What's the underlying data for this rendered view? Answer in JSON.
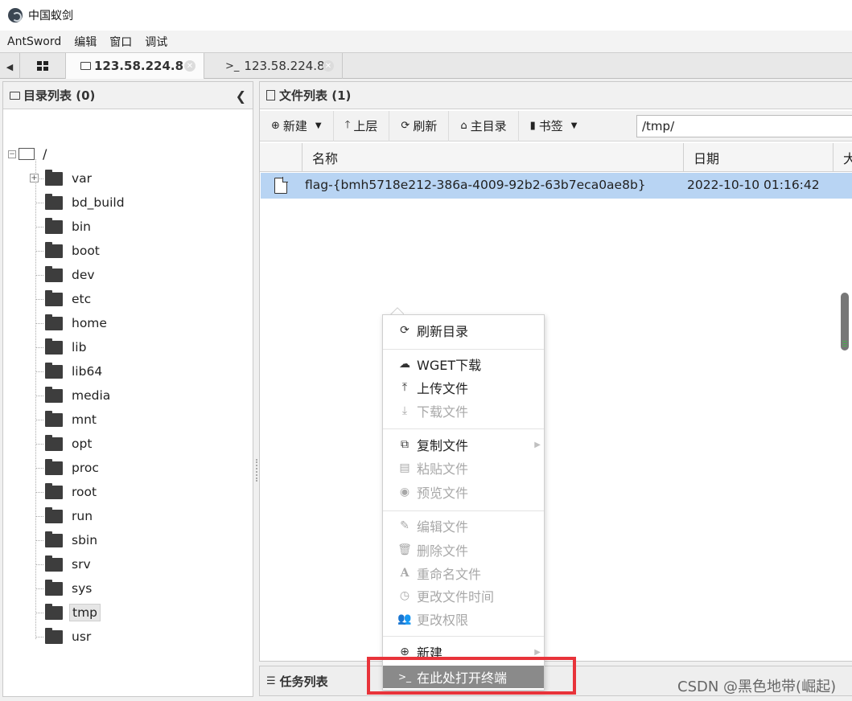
{
  "window": {
    "title": "中国蚁剑",
    "icon": "antsword-logo-icon"
  },
  "menubar": {
    "items": [
      "AntSword",
      "编辑",
      "窗口",
      "调试"
    ]
  },
  "tabs": {
    "left_arrow": "◀",
    "items": [
      {
        "label": "123.58.224.8",
        "icon": "folder-icon",
        "active": true
      },
      {
        "label": "123.58.224.8",
        "icon": "terminal-icon",
        "active": false
      }
    ],
    "close_symbol": "✕"
  },
  "dir_panel": {
    "title": "目录列表 (0)",
    "root_label": "/",
    "nodes": [
      "var",
      "bd_build",
      "bin",
      "boot",
      "dev",
      "etc",
      "home",
      "lib",
      "lib64",
      "media",
      "mnt",
      "opt",
      "proc",
      "root",
      "run",
      "sbin",
      "srv",
      "sys",
      "tmp",
      "usr"
    ],
    "selected": "tmp"
  },
  "file_panel": {
    "title": "文件列表 (1)",
    "toolbar": {
      "new": "新建",
      "up": "上层",
      "refresh": "刷新",
      "home": "主目录",
      "bookmark": "书签"
    },
    "path": "/tmp/",
    "columns": [
      "名称",
      "日期",
      "大"
    ],
    "rows": [
      {
        "name": "flag-{bmh5718e212-386a-4009-92b2-63b7eca0ae8b}",
        "date": "2022-10-10 01:16:42"
      }
    ]
  },
  "task_panel": {
    "title": "任务列表"
  },
  "context_menu": {
    "items": [
      {
        "label": "刷新目录",
        "icon": "refresh-icon",
        "enabled": true
      },
      {
        "label": "WGET下载",
        "icon": "cloud-download-icon",
        "enabled": true
      },
      {
        "label": "上传文件",
        "icon": "upload-icon",
        "enabled": true
      },
      {
        "label": "下载文件",
        "icon": "download-icon",
        "enabled": false
      },
      {
        "label": "复制文件",
        "icon": "copy-icon",
        "enabled": true,
        "submenu": true
      },
      {
        "label": "粘贴文件",
        "icon": "paste-icon",
        "enabled": false
      },
      {
        "label": "预览文件",
        "icon": "eye-icon",
        "enabled": false
      },
      {
        "label": "编辑文件",
        "icon": "edit-icon",
        "enabled": false
      },
      {
        "label": "删除文件",
        "icon": "trash-icon",
        "enabled": false
      },
      {
        "label": "重命名文件",
        "icon": "font-icon",
        "enabled": false
      },
      {
        "label": "更改文件时间",
        "icon": "clock-icon",
        "enabled": false
      },
      {
        "label": "更改权限",
        "icon": "users-icon",
        "enabled": false
      },
      {
        "label": "新建",
        "icon": "plus-circle-icon",
        "enabled": true,
        "submenu": true
      },
      {
        "label": "在此处打开终端",
        "icon": "terminal-icon",
        "enabled": true,
        "highlighted": true
      }
    ]
  },
  "watermark": "CSDN @黑色地带(崛起)",
  "colors": {
    "selection": "#b8d4f3",
    "highlight_box": "#e8333a",
    "menu_hover": "#8a8a8a"
  }
}
